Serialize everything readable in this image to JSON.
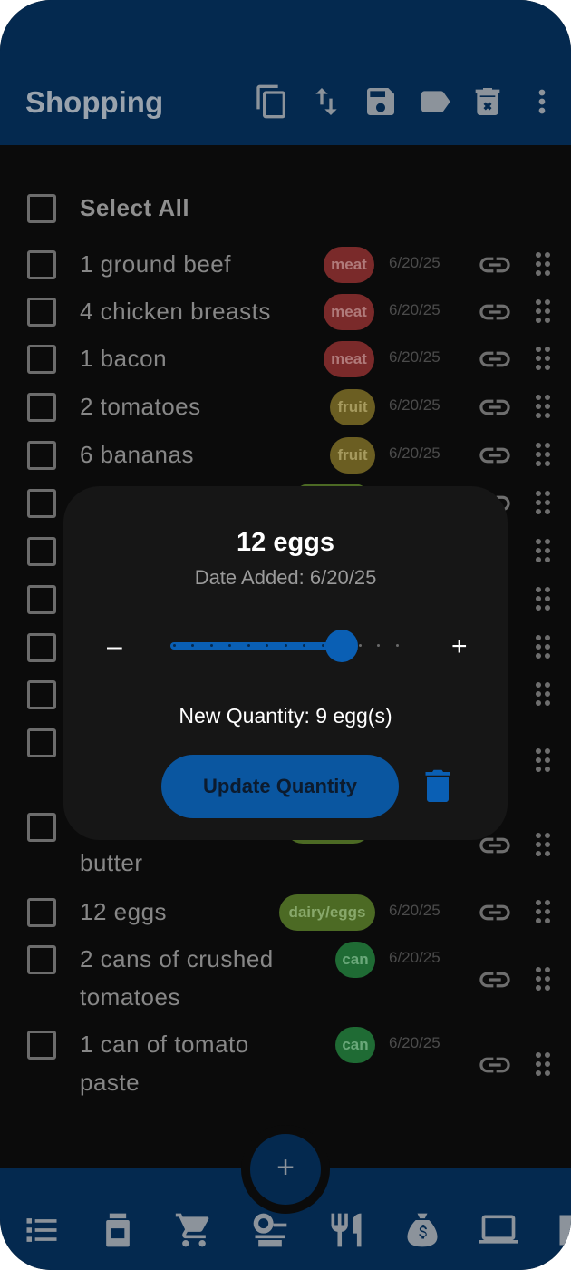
{
  "app_bar": {
    "title": "Shopping",
    "icons": [
      "copy-icon",
      "sort-icon",
      "save-icon",
      "label-icon",
      "delete-list-icon",
      "more-vert-icon"
    ]
  },
  "select_all_label": "Select All",
  "items": [
    {
      "text": "1 ground beef",
      "tag": "meat",
      "date": "6/20/25"
    },
    {
      "text": "4 chicken breasts",
      "tag": "meat",
      "date": "6/20/25"
    },
    {
      "text": "1 bacon",
      "tag": "meat",
      "date": "6/20/25"
    },
    {
      "text": "2 tomatoes",
      "tag": "fruit",
      "date": "6/20/25"
    },
    {
      "text": "6 bananas",
      "tag": "fruit",
      "date": "6/20/25"
    },
    {
      "text": "butter",
      "tag": "",
      "date": ""
    },
    {
      "text": "12 eggs",
      "tag": "dairy/eggs",
      "date": "6/20/25"
    },
    {
      "text": "2 cans of crushed tomatoes",
      "tag": "can",
      "date": "6/20/25"
    },
    {
      "text": "1 can of tomato paste",
      "tag": "can",
      "date": "6/20/25"
    }
  ],
  "tag_colors": {
    "meat": "#7a2a2a",
    "fruit": "#6b5e22",
    "dairy/eggs": "#4c6a24",
    "can": "#1f6b34"
  },
  "dialog": {
    "title": "12 eggs",
    "date_added": "Date Added: 6/20/25",
    "minus_label": "–",
    "plus_label": "+",
    "slider_value": 9,
    "slider_max": 12,
    "new_quantity": "New Quantity: 9 egg(s)",
    "update_button": "Update Quantity"
  },
  "fab_label": "+",
  "bottom_nav": [
    "list-icon",
    "pantry-jar-icon",
    "cart-icon",
    "kitchen-tools-icon",
    "restaurant-icon",
    "money-bag-icon",
    "computer-icon"
  ],
  "colors": {
    "app_bar": "#04294f",
    "accent": "#0a5fb4",
    "background": "#0b0b0b"
  }
}
